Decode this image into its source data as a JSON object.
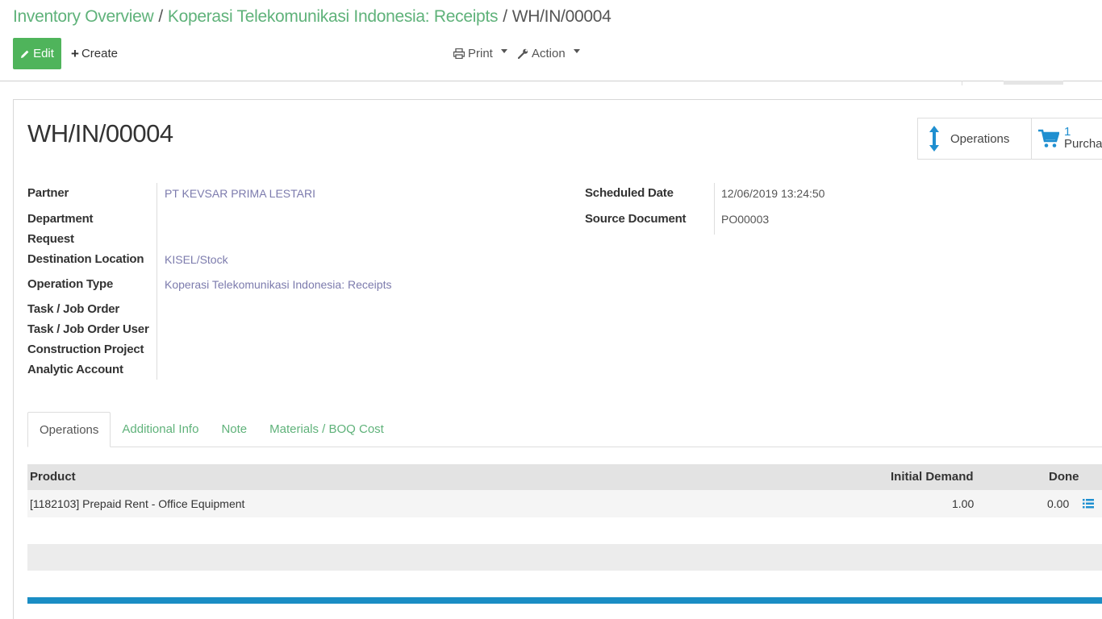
{
  "breadcrumb": {
    "items": [
      "Inventory Overview",
      "Koperasi Telekomunikasi Indonesia: Receipts"
    ],
    "separator": "/",
    "current": "WH/IN/00004"
  },
  "toolbar": {
    "edit_label": "Edit",
    "create_label": "Create",
    "print_label": "Print",
    "action_label": "Action"
  },
  "record": {
    "title": "WH/IN/00004"
  },
  "smart_buttons": {
    "operations_label": "Operations",
    "purchase_count": "1",
    "purchase_label": "Purcha"
  },
  "fields_left": {
    "partner_label": "Partner",
    "partner_value": "PT KEVSAR PRIMA LESTARI",
    "department_label_1": "Department",
    "department_label_2": "Request",
    "destination_label": "Destination Location",
    "destination_value": "KISEL/Stock",
    "operation_type_label": "Operation Type",
    "operation_type_value": "Koperasi Telekomunikasi Indonesia: Receipts",
    "task_label": "Task / Job Order",
    "task_user_label": "Task / Job Order User",
    "construction_label": "Construction Project",
    "analytic_label": "Analytic Account"
  },
  "fields_right": {
    "scheduled_label": "Scheduled Date",
    "scheduled_value": "12/06/2019 13:24:50",
    "source_label": "Source Document",
    "source_value": "PO00003"
  },
  "tabs": [
    "Operations",
    "Additional Info",
    "Note",
    "Materials / BOQ Cost"
  ],
  "table": {
    "headers": {
      "product": "Product",
      "initial_demand": "Initial Demand",
      "done": "Done"
    },
    "rows": [
      {
        "product": "[1182103] Prepaid Rent - Office Equipment",
        "initial_demand": "1.00",
        "done": "0.00"
      }
    ]
  },
  "colors": {
    "brand_green": "#4fb45b",
    "link_green": "#5fb27a",
    "link_purple": "#7c7bad",
    "accent_blue": "#1a8dc4"
  }
}
